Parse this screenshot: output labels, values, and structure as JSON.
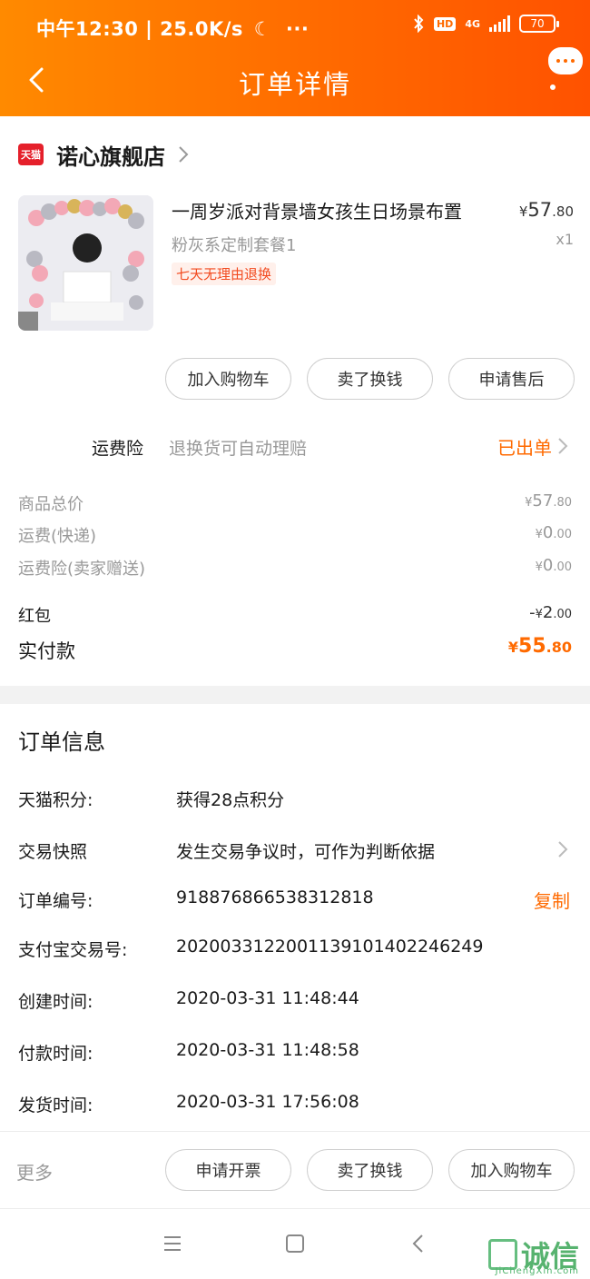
{
  "status_bar": {
    "time_speed": "中午12:30 | 25.0K/s",
    "hd": "HD",
    "network": "4G",
    "battery": "70"
  },
  "header": {
    "title": "订单详情"
  },
  "store": {
    "logo_text": "天猫",
    "name": "诺心旗舰店"
  },
  "product": {
    "title": "一周岁派对背景墙女孩生日场景布置",
    "price_symbol": "¥",
    "price_int": "57",
    "price_dec": ".80",
    "spec": "粉灰系定制套餐1",
    "qty": "x1",
    "badge": "七天无理由退换"
  },
  "product_actions": {
    "add_cart": "加入购物车",
    "resell": "卖了换钱",
    "after_sale": "申请售后"
  },
  "insurance": {
    "label": "运费险",
    "desc": "退换货可自动理赔",
    "status": "已出单"
  },
  "price_rows": {
    "goods_label": "商品总价",
    "goods_int": "57",
    "goods_dec": ".80",
    "ship_label": "运费(快递)",
    "ship_int": "0",
    "ship_dec": ".00",
    "ship_ins_label": "运费险(卖家赠送)",
    "ship_ins_int": "0",
    "ship_ins_dec": ".00",
    "redpack_label": "红包",
    "redpack_prefix": "-",
    "redpack_int": "2",
    "redpack_dec": ".00",
    "paid_label": "实付款",
    "paid_int": "55",
    "paid_dec": ".80",
    "symbol": "¥"
  },
  "order_info": {
    "title": "订单信息",
    "points_label": "天猫积分:",
    "points_value": "获得28点积分",
    "snapshot_label": "交易快照",
    "snapshot_value": "发生交易争议时，可作为判断依据",
    "order_no_label": "订单编号:",
    "order_no_value": "918876866538312818",
    "copy": "复制",
    "alipay_label": "支付宝交易号:",
    "alipay_value": "2020033122001139101402246249",
    "created_label": "创建时间:",
    "created_value": "2020-03-31 11:48:44",
    "paid_label": "付款时间:",
    "paid_value": "2020-03-31 11:48:58",
    "shipped_label": "发货时间:",
    "shipped_value": "2020-03-31 17:56:08"
  },
  "bottom": {
    "more": "更多",
    "invoice": "申请开票",
    "resell": "卖了换钱",
    "add_cart": "加入购物车"
  },
  "watermark": {
    "text": "诚信",
    "sub": "JiChengXin.com"
  },
  "colors": {
    "brand": "#ff6a00",
    "tmall_red": "#e5202b",
    "muted": "#999999"
  }
}
